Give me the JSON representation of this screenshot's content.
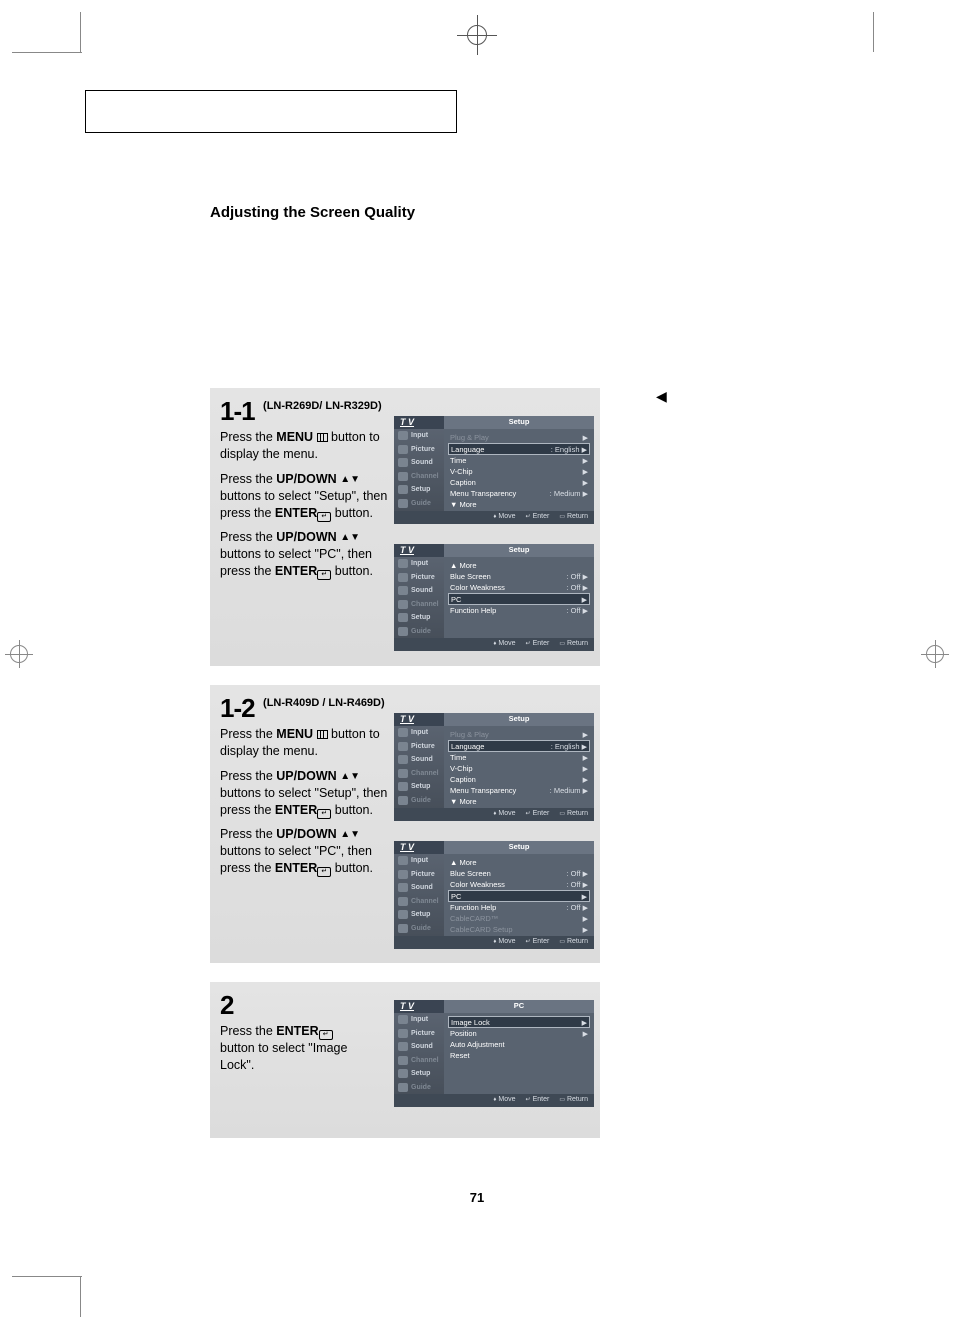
{
  "page_number": "71",
  "title_box": "",
  "section_title": "Adjusting the Screen Quality",
  "steps": {
    "s1": {
      "num": "1-1",
      "model": "(LN-R269D/ LN-R329D)",
      "p1a": "Press the ",
      "p1b": "MENU",
      "p1c": "  button to display the menu.",
      "p2a": "Press the ",
      "p2b": "UP/DOWN",
      "p2c": " buttons to select \"Setup\", then press the ",
      "p2d": "ENTER",
      "p2e": " button.",
      "p3a": "Press the ",
      "p3b": "UP/DOWN",
      "p3c": " buttons to select \"PC\", then press the ",
      "p3d": "ENTER",
      "p3e": " button."
    },
    "s2": {
      "num": "1-2",
      "model": "(LN-R409D / LN-R469D)",
      "p1a": "Press the ",
      "p1b": "MENU",
      "p1c": "  button to display the menu.",
      "p2a": "Press the ",
      "p2b": "UP/DOWN",
      "p2c": " buttons to select \"Setup\", then press the ",
      "p2d": "ENTER",
      "p2e": " button.",
      "p3a": "Press the ",
      "p3b": "UP/DOWN",
      "p3c": " buttons to select \"PC\", then press the ",
      "p3d": "ENTER",
      "p3e": " button."
    },
    "s3": {
      "num": "2",
      "p1a": "Press the ",
      "p1b": "ENTER",
      "p1c": " button to select \"Image Lock\"."
    }
  },
  "osd": {
    "side": {
      "input": "Input",
      "picture": "Picture",
      "sound": "Sound",
      "channel": "Channel",
      "setup": "Setup",
      "guide": "Guide"
    },
    "ftr": {
      "move": "Move",
      "enter": "Enter",
      "return": "Return"
    },
    "setup1": {
      "title": "Setup",
      "rows": [
        {
          "l": "Plug & Play",
          "v": "",
          "ar": "▶",
          "dim": true
        },
        {
          "l": "Language",
          "v": ": English",
          "ar": "▶",
          "sel": true
        },
        {
          "l": "Time",
          "v": "",
          "ar": "▶"
        },
        {
          "l": "V-Chip",
          "v": "",
          "ar": "▶"
        },
        {
          "l": "Caption",
          "v": "",
          "ar": "▶"
        },
        {
          "l": "Menu Transparency",
          "v": ": Medium",
          "ar": "▶"
        },
        {
          "l": "▼ More",
          "v": "",
          "ar": ""
        }
      ]
    },
    "setup2": {
      "title": "Setup",
      "rows": [
        {
          "l": "▲ More",
          "v": "",
          "ar": ""
        },
        {
          "l": "Blue Screen",
          "v": ": Off",
          "ar": "▶"
        },
        {
          "l": "Color Weakness",
          "v": ": Off",
          "ar": "▶"
        },
        {
          "l": "PC",
          "v": "",
          "ar": "▶",
          "sel": true
        },
        {
          "l": "Function Help",
          "v": ": Off",
          "ar": "▶"
        }
      ]
    },
    "setup3": {
      "title": "Setup",
      "rows": [
        {
          "l": "▲ More",
          "v": "",
          "ar": ""
        },
        {
          "l": "Blue Screen",
          "v": ": Off",
          "ar": "▶"
        },
        {
          "l": "Color Weakness",
          "v": ": Off",
          "ar": "▶"
        },
        {
          "l": "PC",
          "v": "",
          "ar": "▶",
          "sel": true
        },
        {
          "l": "Function Help",
          "v": ": Off",
          "ar": "▶"
        },
        {
          "l": "CableCARD™",
          "v": "",
          "ar": "▶",
          "dim": true
        },
        {
          "l": "CableCARD Setup",
          "v": "",
          "ar": "▶",
          "dim": true
        }
      ]
    },
    "pc": {
      "title": "PC",
      "rows": [
        {
          "l": "Image Lock",
          "v": "",
          "ar": "▶",
          "sel": true
        },
        {
          "l": "Position",
          "v": "",
          "ar": "▶"
        },
        {
          "l": "Auto Adjustment",
          "v": "",
          "ar": ""
        },
        {
          "l": "Reset",
          "v": "",
          "ar": ""
        }
      ]
    },
    "tv": "T V"
  }
}
